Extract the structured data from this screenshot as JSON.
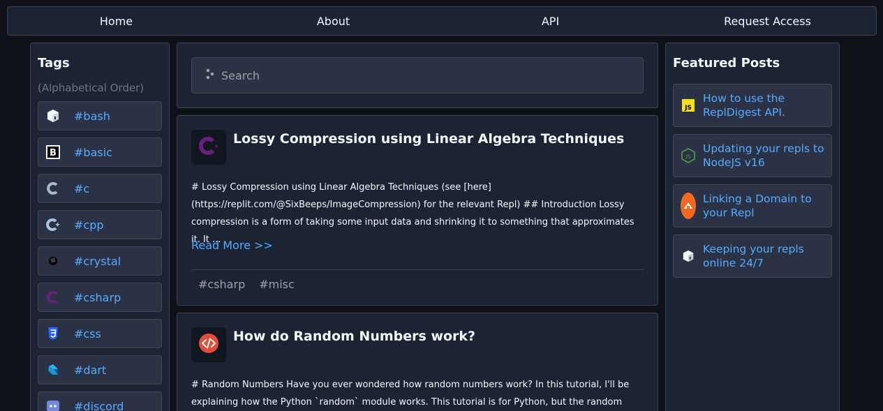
{
  "nav": {
    "items": [
      "Home",
      "About",
      "API",
      "Request Access"
    ]
  },
  "tags": {
    "title": "Tags",
    "subtitle": "(Alphabetical Order)",
    "items": [
      "#bash",
      "#basic",
      "#c",
      "#cpp",
      "#crystal",
      "#csharp",
      "#css",
      "#dart",
      "#discord"
    ]
  },
  "search": {
    "placeholder": "Search"
  },
  "posts": [
    {
      "title": "Lossy Compression using Linear Algebra Techniques",
      "excerpt": "# Lossy Compression using Linear Algebra Techniques (see [here](https://replit.com/@SixBeeps/ImageCompression) for the relevant Repl) ## Introduction Lossy compression is a form of taking some input data and shrinking it to something that approximates it. It ...",
      "read_more": "Read More >>",
      "tags": [
        "#csharp",
        "#misc"
      ]
    },
    {
      "title": "How do Random Numbers work?",
      "excerpt": "# Random Numbers Have you ever wondered how random numbers work? In this tutorial, I'll be explaining how the Python `random` module works. This tutorial is for Python, but the random number"
    }
  ],
  "featured": {
    "title": "Featured Posts",
    "items": [
      "How to use the ReplDigest API.",
      "Updating your repls to NodeJS v16",
      "Linking a Domain to your Repl",
      "Keeping your repls online 24/7"
    ]
  },
  "colors": {
    "background": "#0e1118",
    "panel": "#1c2333",
    "link": "#57abff",
    "muted": "#9da2a6"
  }
}
